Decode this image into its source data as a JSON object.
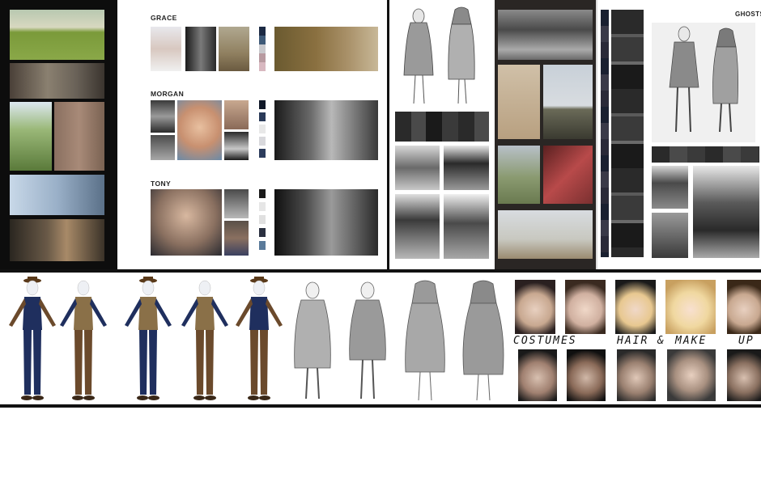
{
  "board1": {
    "characters": [
      {
        "name": "GRACE"
      },
      {
        "name": "MORGAN"
      },
      {
        "name": "TONY"
      }
    ]
  },
  "board3": {
    "title": "GHOSTS"
  },
  "strip": {
    "words": [
      "COSTUMES",
      "HAIR",
      "&",
      "MAKE",
      "UP"
    ]
  },
  "colors": {
    "grace_swatches": [
      "#1c2a44",
      "#3f5a78",
      "#c8c8cc",
      "#b89aa0",
      "#d8b8c0"
    ],
    "morgan_swatches": [
      "#101828",
      "#2a3a58",
      "#e8e8e8",
      "#d8d8dc",
      "#2c3c5c"
    ],
    "tony_swatches": [
      "#1a1a1a",
      "#e6e6e6",
      "#e0e0e0",
      "#2a3040",
      "#5a7a9a"
    ],
    "costume_navy": "#1f2f5e",
    "costume_brown": "#6b4a2c",
    "costume_vest": "#8a7048"
  }
}
